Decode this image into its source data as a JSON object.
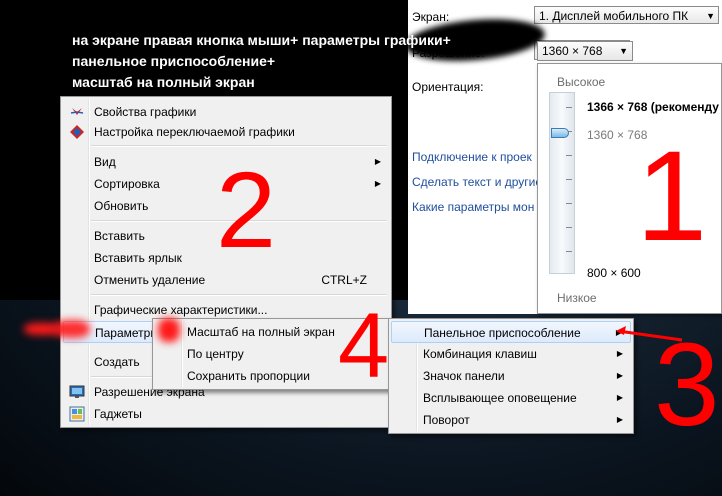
{
  "settings": {
    "screen_label": "Экран:",
    "screen_value": "1. Дисплей мобильного ПК",
    "resolution_label": "Разрешение:",
    "resolution_value": "1360 × 768",
    "orientation_label": "Ориентация:",
    "links": [
      "Подключение к проек",
      "Сделать текст и другие",
      "Какие параметры мон"
    ]
  },
  "resolution_dropdown": {
    "high": "Высокое",
    "recommended": "1366 × 768 (рекоменду",
    "current": "1360 × 768",
    "min": "800 × 600",
    "low": "Низкое",
    "slider_level": 0.2
  },
  "instruction": {
    "line1": "на  экране правая кнопка мыши+ параметры графики+",
    "line2": "панельное приспособление+",
    "line3": "масштаб на полный экран"
  },
  "context_menu": {
    "items": [
      {
        "label": "Свойства графики",
        "icon": "graphics-icon"
      },
      {
        "label": "Настройка переключаемой графики",
        "icon": "switchable-graphics-icon"
      },
      {
        "label": "Вид"
      },
      {
        "label": "Сортировка"
      },
      {
        "label": "Обновить"
      },
      {
        "label": "Вставить"
      },
      {
        "label": "Вставить ярлык"
      },
      {
        "label": "Отменить удаление",
        "shortcut": "CTRL+Z"
      },
      {
        "label": "Графические характеристики..."
      },
      {
        "label": "Параметры графики"
      },
      {
        "label": "Создать"
      },
      {
        "label": "Разрешение экрана",
        "icon": "screen-resolution-icon"
      },
      {
        "label": "Гаджеты",
        "icon": "gadgets-icon"
      }
    ]
  },
  "scale_menu": {
    "items": [
      "Масштаб на полный экран",
      "По центру",
      "Сохранить пропорции"
    ]
  },
  "params_menu": {
    "items": [
      "Панельное приспособление",
      "Комбинация клавиш",
      "Значок панели",
      "Всплывающее оповещение",
      "Поворот"
    ]
  },
  "annotations": {
    "n1": "1",
    "n2": "2",
    "n3": "3",
    "n4": "4"
  },
  "colors": {
    "annotation": "#ff0000",
    "link": "#1f4f9c",
    "highlight": "#dceafb"
  }
}
